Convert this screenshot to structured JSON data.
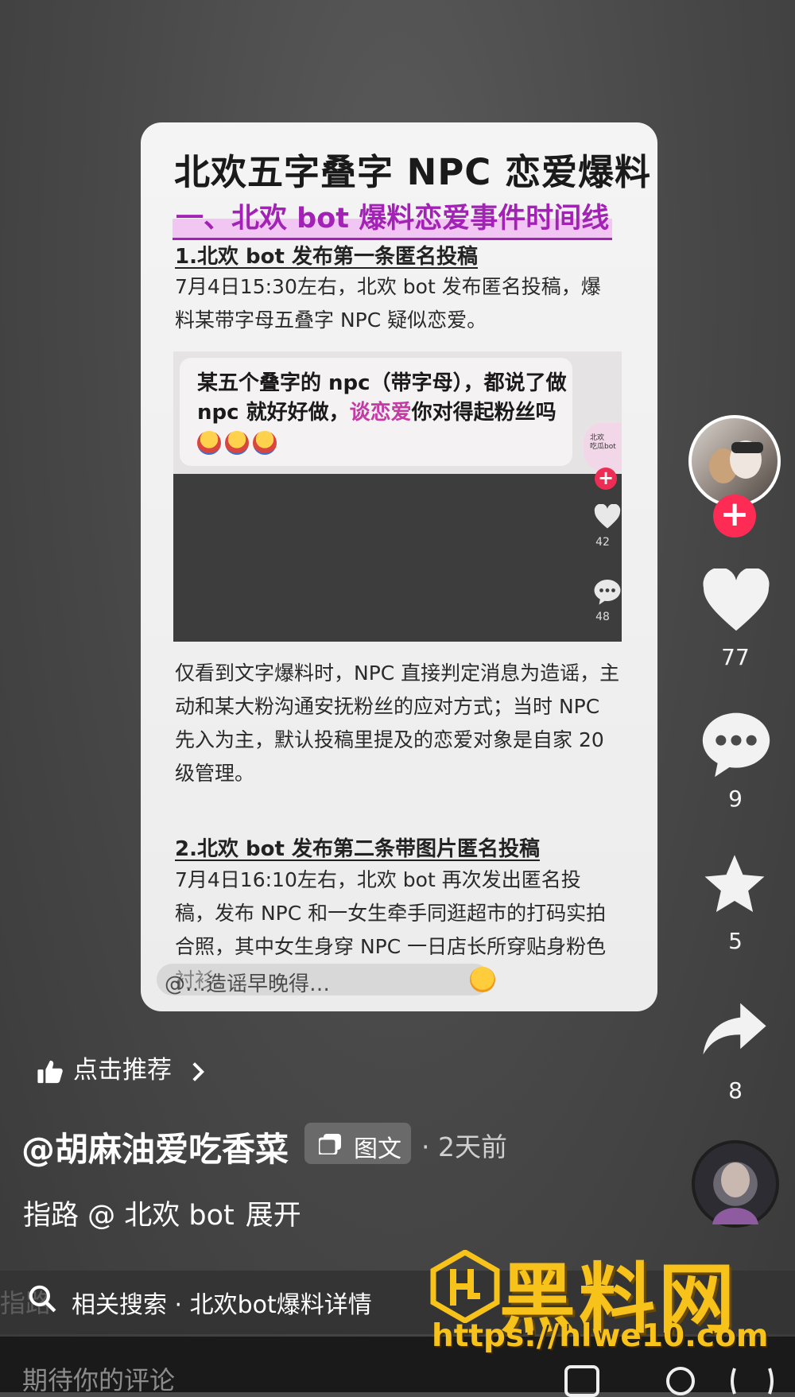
{
  "card": {
    "title": "北欢五字叠字 NPC 恋爱爆料",
    "section_heading": "一、北欢 bot 爆料恋爱事件时间线",
    "item1_heading": "1.北欢 bot 发布第一条匿名投稿",
    "item1_body": "7月4日15:30左右，北欢 bot 发布匿名投稿，爆料某带字母五叠字 NPC 疑似恋爱。",
    "embed": {
      "post_text_before": "某五个叠字的 npc（带字母），都说了做 npc 就好好做，",
      "post_text_highlight": "谈恋爱",
      "post_text_after": "你对得起粉丝吗",
      "mini_avatar_text": "北欢\n吃瓜bot",
      "like_count": "42",
      "comment_count": "48"
    },
    "analysis": "仅看到文字爆料时，NPC 直接判定消息为造谣，主动和某大粉沟通安抚粉丝的应对方式；当时 NPC 先入为主，默认投稿里提及的恋爱对象是自家 20 级管理。",
    "item2_heading": "2.北欢 bot 发布第二条带图片匿名投稿",
    "item2_body": "7月4日16:10左右，北欢 bot 再次发出匿名投稿，发布 NPC 和一女生牵手同逛超市的打码实拍合照，其中女生身穿 NPC 一日店长所穿贴身粉色衬衫。",
    "overlay_text": "@…造谣早晚得…"
  },
  "rail": {
    "like_count": "77",
    "comment_count": "9",
    "favorite_count": "5",
    "share_count": "8"
  },
  "recommend_label": "点击推荐",
  "author": "@胡麻油爱吃香菜",
  "post_type": "图文",
  "time": "· 2天前",
  "caption": {
    "text": "指路 @ 北欢 bot",
    "expand": "展开"
  },
  "search": {
    "ghost": "指路",
    "text": "相关搜索 · 北欢bot爆料详情"
  },
  "comment_placeholder": "期待你的评论",
  "watermark": {
    "brand": "黑料网",
    "url": "https://hlwe10.com"
  },
  "colors": {
    "accent_pink": "#fe2c55",
    "highlight_purple": "#a222b5",
    "watermark_gold": "#f7c21a"
  }
}
